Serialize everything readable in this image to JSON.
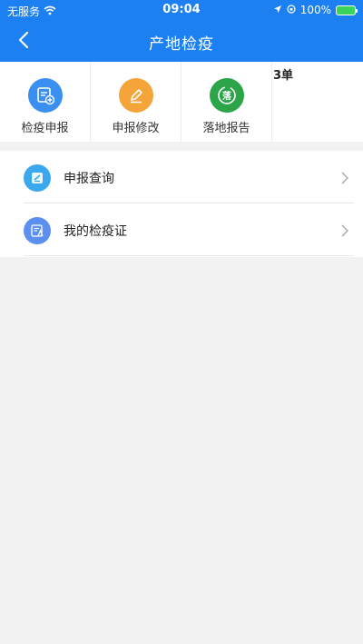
{
  "status_bar": {
    "carrier": "无服务",
    "time": "09:04",
    "battery": "100%"
  },
  "nav": {
    "title": "产地检疫"
  },
  "quick_actions": [
    {
      "label": "检疫申报",
      "icon": "declare-icon",
      "color": "#3a8ff0"
    },
    {
      "label": "申报修改",
      "icon": "edit-icon",
      "color": "#f5a43a"
    },
    {
      "label": "落地报告",
      "icon": "landing-icon",
      "color": "#2ba44a",
      "glyph": "落",
      "badge": "3单"
    }
  ],
  "list": [
    {
      "label": "申报查询",
      "icon": "query-icon",
      "color": "#3aa8ee"
    },
    {
      "label": "我的检疫证",
      "icon": "certificate-icon",
      "color": "#5b8ff0"
    }
  ],
  "colors": {
    "header": "#1c7ff2",
    "background": "#f2f2f2"
  }
}
